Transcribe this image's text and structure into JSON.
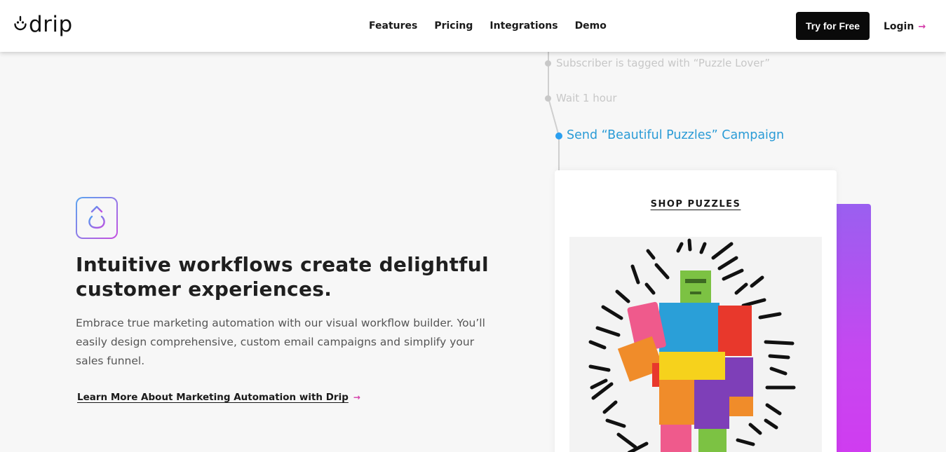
{
  "header": {
    "logo_text": "drip",
    "nav": [
      {
        "label": "Features"
      },
      {
        "label": "Pricing"
      },
      {
        "label": "Integrations"
      },
      {
        "label": "Demo"
      }
    ],
    "cta_label": "Try for Free",
    "login_label": "Login",
    "login_arrow": "→"
  },
  "hero": {
    "icon": "workflow-drip-icon",
    "headline": "Intuitive workflows create delightful customer experiences.",
    "description": "Embrace true marketing automation with our visual workflow builder. You’ll easily design comprehensive, custom email campaigns and simplify your sales funnel.",
    "learn_more": "Learn More About Marketing Automation with Drip",
    "learn_arrow": "→"
  },
  "workflow": {
    "steps": [
      {
        "label": "Subscriber is tagged with “Puzzle Lover”",
        "active": false
      },
      {
        "label": "Wait 1 hour",
        "active": false
      },
      {
        "label": "Send “Beautiful Puzzles” Campaign",
        "active": true
      }
    ]
  },
  "email_card": {
    "heading": "SHOP PUZZLES",
    "image": "colorful-wooden-puzzle-robot-image"
  },
  "colors": {
    "accent_pink": "#d43aa8",
    "active_blue": "#2a9bd6",
    "purple_gradient_start": "#9a5ff0",
    "purple_gradient_end": "#d03cf0"
  }
}
